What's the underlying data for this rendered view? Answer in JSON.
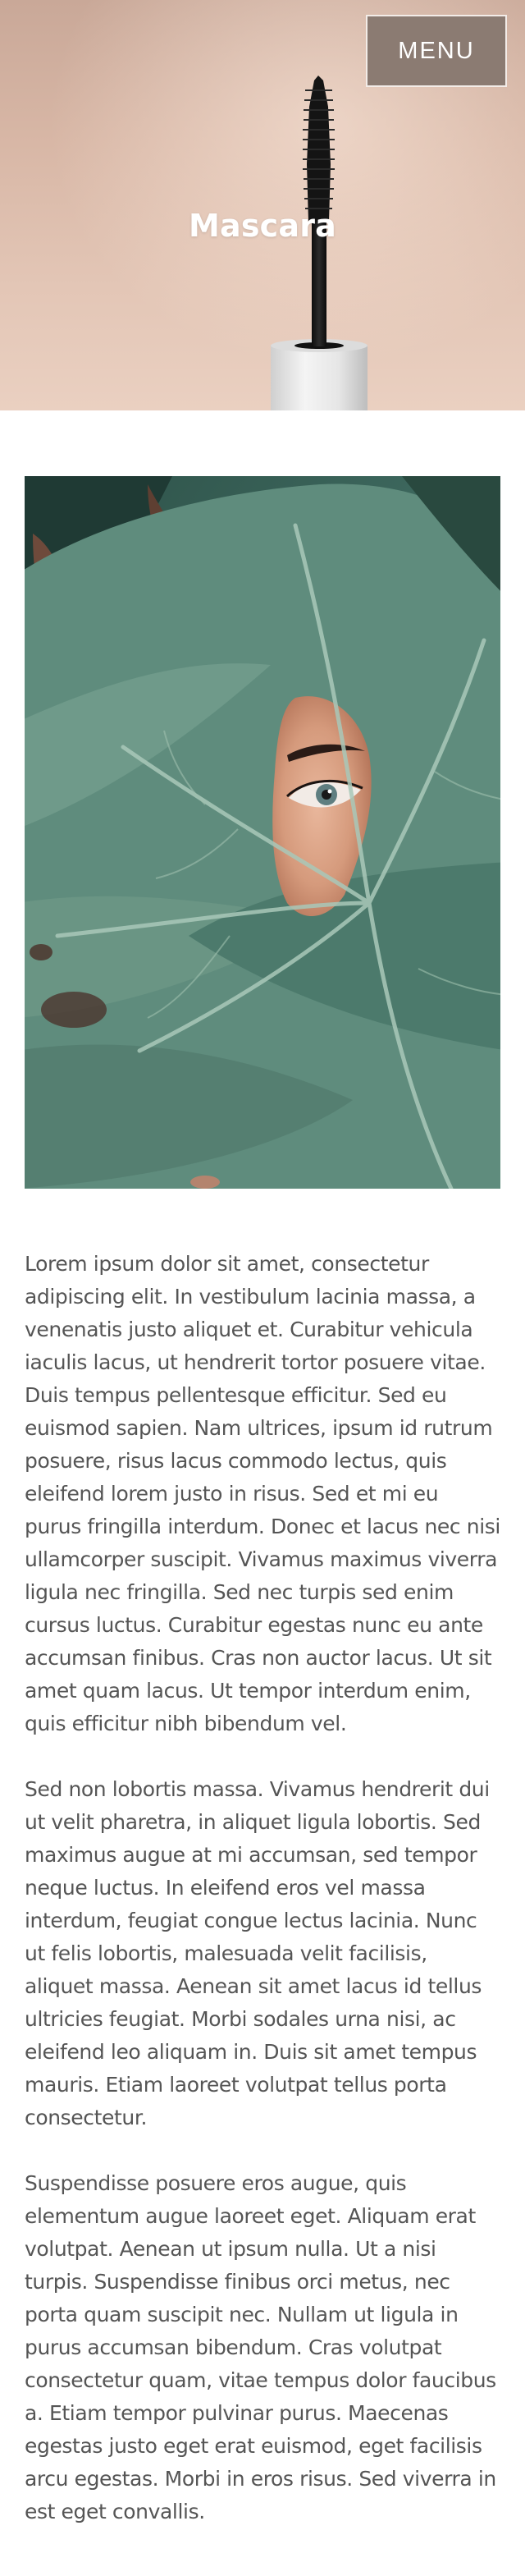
{
  "header": {
    "menu_label": "MENU"
  },
  "hero": {
    "title": "Mascara"
  },
  "feature_image": {
    "subject": "eye peeking through a large green leaf"
  },
  "article": {
    "paragraphs": [
      "Lorem ipsum dolor sit amet, consectetur adipiscing elit. In vestibulum lacinia massa, a venenatis justo aliquet et. Curabitur vehicula iaculis lacus, ut hendrerit tortor posuere vitae. Duis tempus pellentesque efficitur. Sed eu euismod sapien. Nam ultrices, ipsum id rutrum posuere, risus lacus commodo lectus, quis eleifend lorem justo in risus. Sed et mi eu purus fringilla interdum. Donec et lacus nec nisi ullamcorper suscipit. Vivamus maximus viverra ligula nec fringilla. Sed nec turpis sed enim cursus luctus. Curabitur egestas nunc eu ante accumsan finibus. Cras non auctor lacus. Ut sit amet quam lacus. Ut tempor interdum enim, quis efficitur nibh bibendum vel.",
      "Sed non lobortis massa. Vivamus hendrerit dui ut velit pharetra, in aliquet ligula lobortis. Sed maximus augue at mi accumsan, sed tempor neque luctus. In eleifend eros vel massa interdum, feugiat congue lectus lacinia. Nunc ut felis lobortis, malesuada velit facilisis, aliquet massa. Aenean sit amet lacus id tellus ultricies feugiat. Morbi sodales urna nisi, ac eleifend leo aliquam in. Duis sit amet tempus mauris. Etiam laoreet volutpat tellus porta consectetur.",
      "Suspendisse posuere eros augue, quis elementum augue laoreet eget. Aliquam erat volutpat. Aenean ut ipsum nulla. Ut a nisi turpis. Suspendisse finibus orci metus, nec porta quam suscipit nec. Nullam ut ligula in purus accumsan bibendum. Cras volutpat consectetur quam, vitae tempus dolor faucibus a. Etiam tempor pulvinar purus. Maecenas egestas justo eget erat euismod, eget facilisis arcu egestas. Morbi in eros risus. Sed viverra in est eget convallis."
    ]
  },
  "colors": {
    "menu_background": "#8b7b72",
    "menu_border": "#f3ece8",
    "hero_background": "#d8b7a6",
    "body_text": "#555555",
    "leaf_green": "#3f6a60"
  }
}
